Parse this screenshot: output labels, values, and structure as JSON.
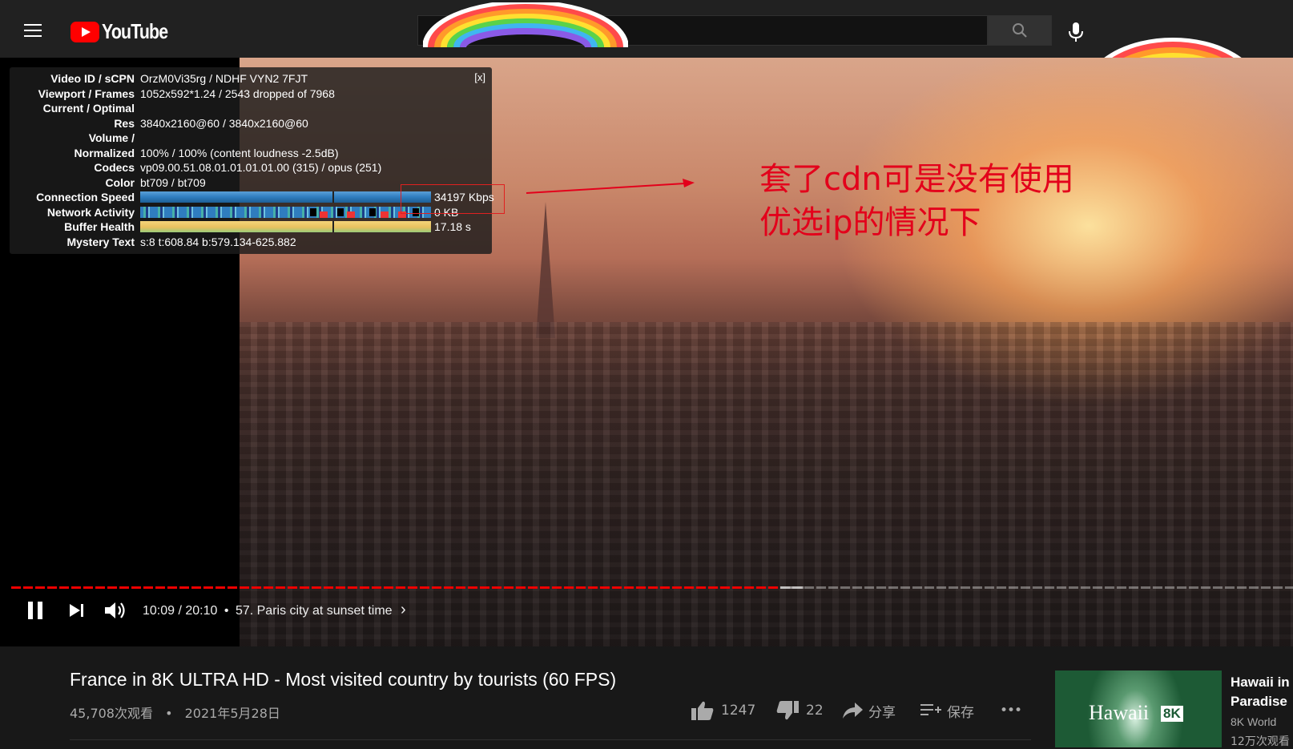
{
  "header": {
    "logo_text": "YouTube",
    "search_value": ""
  },
  "stats": {
    "close_label": "[x]",
    "rows": [
      {
        "label": "Video ID / sCPN",
        "value": "OrzM0Vi35rg / NDHF VYN2 7FJT"
      },
      {
        "label": "Viewport / Frames",
        "value": "1052x592*1.24 / 2543 dropped of 7968"
      },
      {
        "label": "Current / Optimal",
        "value": ""
      },
      {
        "label": "Res",
        "value": "3840x2160@60 / 3840x2160@60"
      },
      {
        "label": "Volume /",
        "value": ""
      },
      {
        "label": "Normalized",
        "value": "100% / 100% (content loudness -2.5dB)"
      },
      {
        "label": "Codecs",
        "value": "vp09.00.51.08.01.01.01.01.00 (315) / opus (251)"
      },
      {
        "label": "Color",
        "value": "bt709 / bt709"
      },
      {
        "label": "Connection Speed",
        "value": "34197 Kbps"
      },
      {
        "label": "Network Activity",
        "value": "0 KB"
      },
      {
        "label": "Buffer Health",
        "value": "17.18 s"
      },
      {
        "label": "Mystery Text",
        "value": "s:8 t:608.84 b:579.134-625.882"
      }
    ]
  },
  "annotation": {
    "line1": "套了cdn可是没有使用",
    "line2": "优选ip的情况下",
    "color": "#e3001b"
  },
  "player": {
    "progress_fraction": 0.6,
    "buffered_fraction": 0.618,
    "time": "10:09 / 20:10",
    "chapter_separator": "•",
    "chapter": "57. Paris city at sunset time",
    "chapter_chevron": "›"
  },
  "video": {
    "title": "France in 8K ULTRA HD - Most visited country by tourists (60 FPS)",
    "views": "45,708次观看",
    "meta_separator": "•",
    "date": "2021年5月28日",
    "likes": "1247",
    "dislikes": "22",
    "share_label": "分享",
    "save_label": "保存",
    "more_label": "•••"
  },
  "sidebar": {
    "thumb_text": "Hawaii",
    "thumb_badge": "8K",
    "title_line1": "Hawaii in",
    "title_line2": "Paradise",
    "channel": "8K World",
    "views": "12万次观看"
  },
  "colors": {
    "accent": "#ff0000",
    "progress": "#e00000"
  }
}
